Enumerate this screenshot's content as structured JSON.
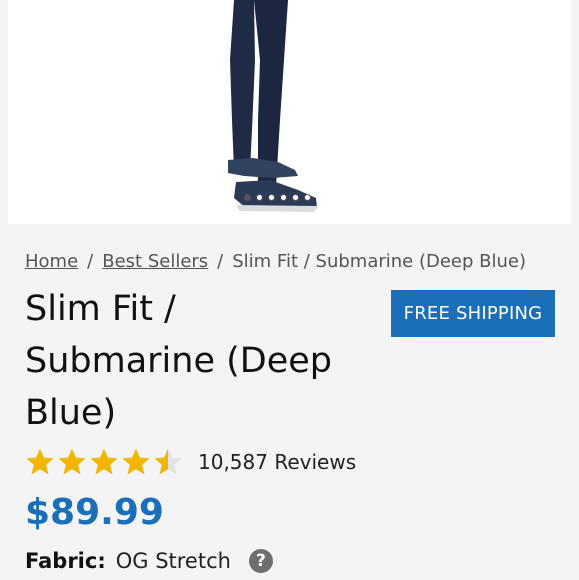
{
  "breadcrumb": {
    "home": "Home",
    "separator": "/",
    "best_sellers": "Best Sellers",
    "current": "Slim Fit / Submarine (Deep Blue)"
  },
  "product": {
    "title": "Slim Fit / Submarine (Deep Blue)",
    "shipping_badge": "FREE SHIPPING",
    "rating": 4.5,
    "rating_max": 5,
    "reviews": "10,587 Reviews",
    "price": "$89.99",
    "fabric_label": "Fabric:",
    "fabric_value": "OG Stretch",
    "help_icon": "?"
  },
  "carousel": {
    "count": 6,
    "active_index": 0
  },
  "colors": {
    "accent": "#1a6fb8",
    "star": "#f2b600"
  }
}
